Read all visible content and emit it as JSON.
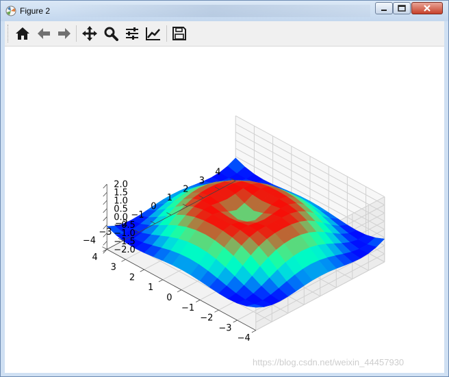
{
  "window": {
    "title": "Figure 2",
    "icon": "matplotlib-icon",
    "controls": [
      "minimize-icon",
      "maximize-icon",
      "close-icon"
    ]
  },
  "toolbar": {
    "buttons": [
      "home-icon",
      "back-icon",
      "forward-icon",
      "pan-icon",
      "zoom-icon",
      "configure-subplots-icon",
      "edit-axis-icon",
      "save-icon"
    ]
  },
  "watermark": "https://blog.csdn.net/weixin_44457930",
  "chart_data": {
    "type": "surface3d",
    "function": "z = sin(sqrt(x^2 + y^2))",
    "colormap": "rainbow",
    "x": [
      -4,
      -3.5,
      -3,
      -2.5,
      -2,
      -1.5,
      -1,
      -0.5,
      0,
      0.5,
      1,
      1.5,
      2,
      2.5,
      3,
      3.5,
      4
    ],
    "y": [
      -4,
      -3.5,
      -3,
      -2.5,
      -2,
      -1.5,
      -1,
      -0.5,
      0,
      0.5,
      1,
      1.5,
      2,
      2.5,
      3,
      3.5,
      4
    ],
    "xlim": [
      -4,
      4
    ],
    "ylim": [
      -4,
      4
    ],
    "zlim": [
      -2,
      2
    ],
    "xticks": [
      "−4",
      "−3",
      "−2",
      "−1",
      "0",
      "1",
      "2",
      "3",
      "4"
    ],
    "yticks": [
      "−4",
      "−3",
      "−2",
      "−1",
      "0",
      "1",
      "2",
      "3",
      "4"
    ],
    "zticks": [
      "−2.0",
      "−1.5",
      "−1.0",
      "−0.5",
      "0.0",
      "0.5",
      "1.0",
      "1.5",
      "2.0"
    ],
    "xlabel": "",
    "ylabel": "",
    "zlabel": "",
    "grid": true
  }
}
